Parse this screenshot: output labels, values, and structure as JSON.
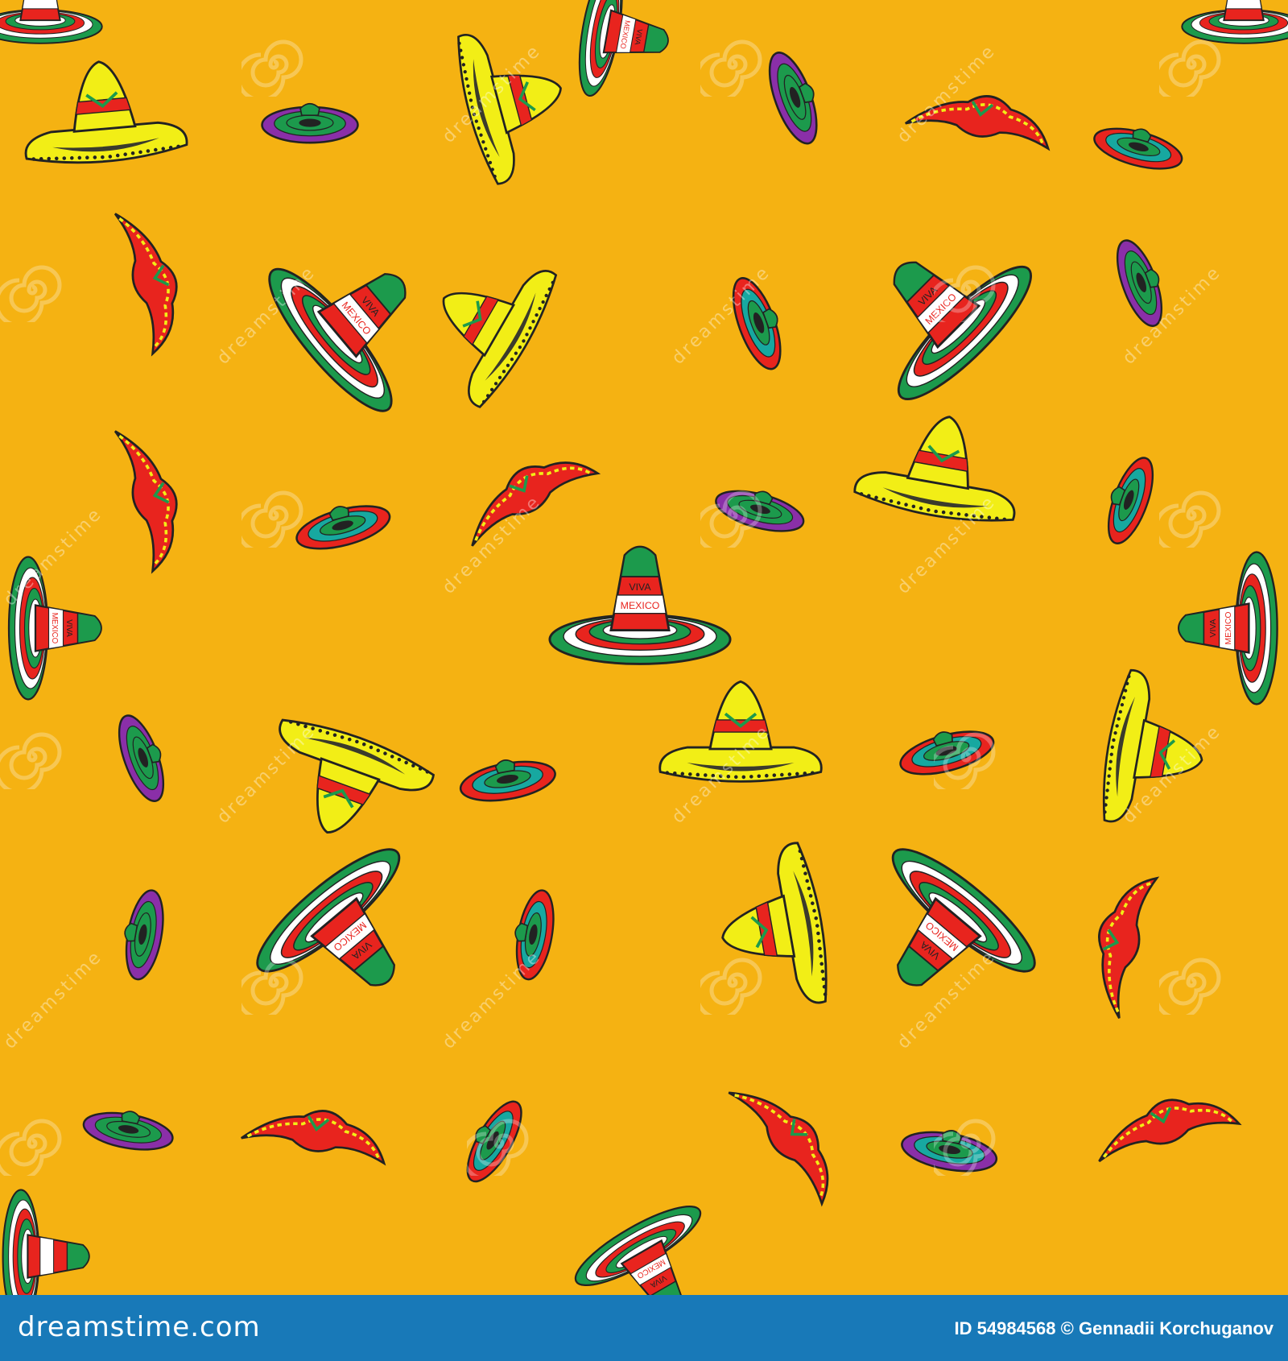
{
  "image": {
    "subject": "seamless sombrero pattern",
    "background_color": "#f5b212",
    "hat_text": {
      "viva": "VIVA",
      "mexico": "MEXICO"
    },
    "palette": {
      "green": "#1c9a4c",
      "red": "#e8241e",
      "white": "#ffffff",
      "yellow": "#f2ee16",
      "purple": "#8a2fa8",
      "teal": "#17a8a0",
      "outline": "#222222"
    }
  },
  "watermark": {
    "text": "dreamstime"
  },
  "footer": {
    "background_color": "#1879b8",
    "logo": "dreamstime.com",
    "id_label": "ID",
    "id_number": "54984568",
    "copyright_symbol": "©",
    "author": "Gennadii Korchuganov"
  }
}
